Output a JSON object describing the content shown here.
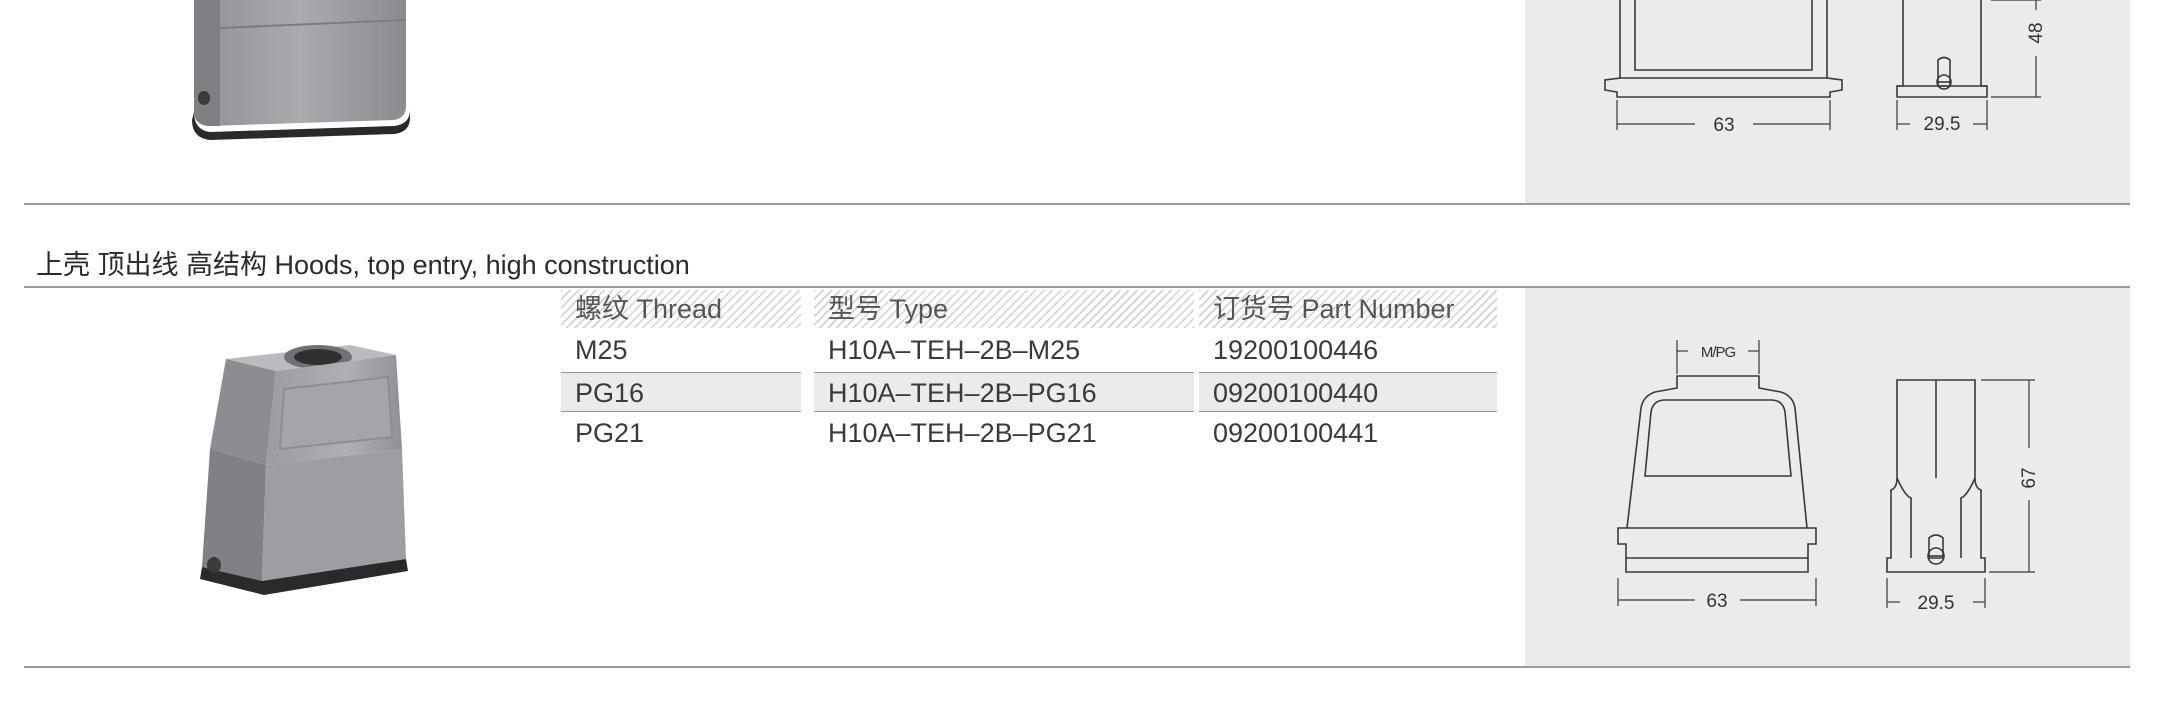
{
  "top_section": {
    "dims": {
      "width": "63",
      "depth": "29.5",
      "height": "48"
    }
  },
  "section": {
    "title": "上壳 顶出线  高结构 Hoods, top entry, high construction",
    "table": {
      "headers": {
        "thread": "螺纹 Thread",
        "type": "型号 Type",
        "part": "订货号 Part Number"
      },
      "rows": [
        {
          "thread": "M25",
          "type": "H10A–TEH–2B–M25",
          "part": "19200100446"
        },
        {
          "thread": "PG16",
          "type": "H10A–TEH–2B–PG16",
          "part": "09200100440"
        },
        {
          "thread": "PG21",
          "type": "H10A–TEH–2B–PG21",
          "part": "09200100441"
        }
      ]
    },
    "dims": {
      "entry": "M/PG",
      "width": "63",
      "depth": "29.5",
      "height": "67"
    }
  }
}
